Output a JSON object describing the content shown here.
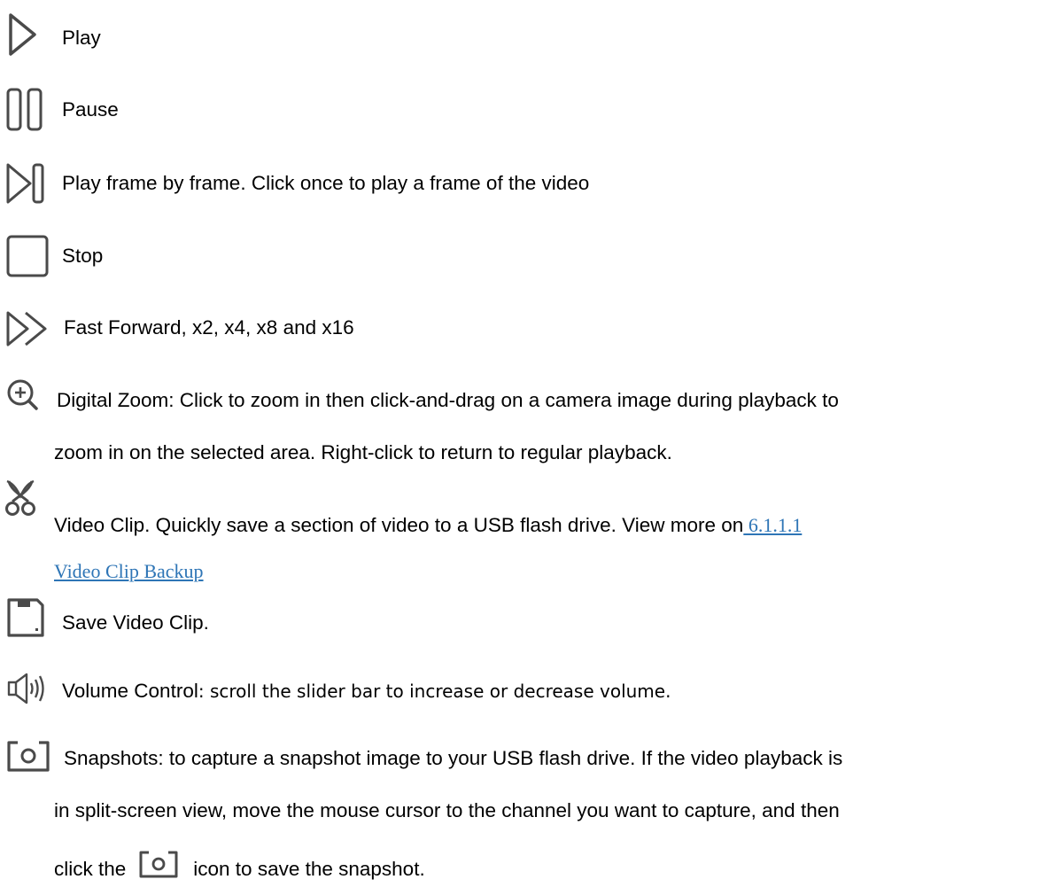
{
  "items": {
    "play": {
      "icon": "play-icon",
      "text": "Play"
    },
    "pause": {
      "icon": "pause-icon",
      "text": "Pause"
    },
    "frame": {
      "icon": "frame-by-frame-icon",
      "text": "Play frame by frame. Click once to play a frame of the video"
    },
    "stop": {
      "icon": "stop-icon",
      "text": "Stop"
    },
    "ff": {
      "icon": "fast-forward-icon",
      "text": "Fast Forward, x2, x4, x8 and x16"
    },
    "zoom": {
      "icon": "zoom-in-icon",
      "line1": "Digital Zoom: Click to zoom in then click-and-drag on a camera image during playback to",
      "line2": "zoom in on the selected area. Right-click to return to regular playback."
    },
    "clip": {
      "icon": "scissors-icon",
      "text": "Video Clip. Quickly save a section of video to a USB flash drive. View more on",
      "link_part1": " 6.1.1.1",
      "link_part2": "Video Clip Backup"
    },
    "save": {
      "icon": "floppy-disk-icon",
      "text": "Save Video Clip."
    },
    "volume": {
      "icon": "speaker-icon",
      "label": "Volume Control",
      "desc": ": scroll the slider bar to increase or decrease volume."
    },
    "snapshot": {
      "icon": "camera-icon",
      "line1": "Snapshots: to capture a snapshot image to your USB flash drive. If the video playback is",
      "line2": "in split-screen view, move the mouse cursor to the channel you want to capture, and then",
      "line3_pre": "click the",
      "line3_post": "icon to save the snapshot."
    }
  },
  "colors": {
    "icon": "#4a4a4a",
    "link": "#2e75b6",
    "text": "#000000"
  }
}
